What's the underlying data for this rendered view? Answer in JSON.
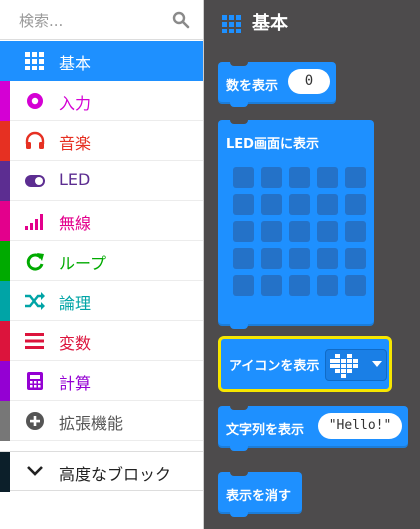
{
  "search": {
    "placeholder": "検索..."
  },
  "categories": [
    {
      "label": "基本",
      "color": "#1e90ff",
      "icon": "grid-icon",
      "selected": true
    },
    {
      "label": "入力",
      "color": "#d400d4",
      "icon": "input-circle-icon"
    },
    {
      "label": "音楽",
      "color": "#e63022",
      "icon": "headphones-icon"
    },
    {
      "label": "LED",
      "color": "#5c2d91",
      "icon": "toggle-icon"
    },
    {
      "label": "無線",
      "color": "#e3008c",
      "icon": "signal-bars-icon"
    },
    {
      "label": "ループ",
      "color": "#00aa00",
      "icon": "loop-arrow-icon"
    },
    {
      "label": "論理",
      "color": "#00a4a6",
      "icon": "shuffle-icon"
    },
    {
      "label": "変数",
      "color": "#dc143c",
      "icon": "list-lines-icon"
    },
    {
      "label": "計算",
      "color": "#9400d3",
      "icon": "calculator-icon"
    },
    {
      "label": "拡張機能",
      "color": "#777777",
      "icon": "plus-circle-icon"
    }
  ],
  "advanced": {
    "label": "高度なブロック",
    "icon": "chevron-down-icon"
  },
  "flyout": {
    "title": "基本",
    "blocks": {
      "show_number": {
        "label": "数を表示",
        "value": "0"
      },
      "show_leds": {
        "label": "LED画面に表示"
      },
      "show_icon": {
        "label": "アイコンを表示",
        "icon": "heart-icon"
      },
      "show_string": {
        "label": "文字列を表示",
        "value": "\"Hello!\""
      },
      "clear_screen": {
        "label": "表示を消す"
      }
    }
  }
}
